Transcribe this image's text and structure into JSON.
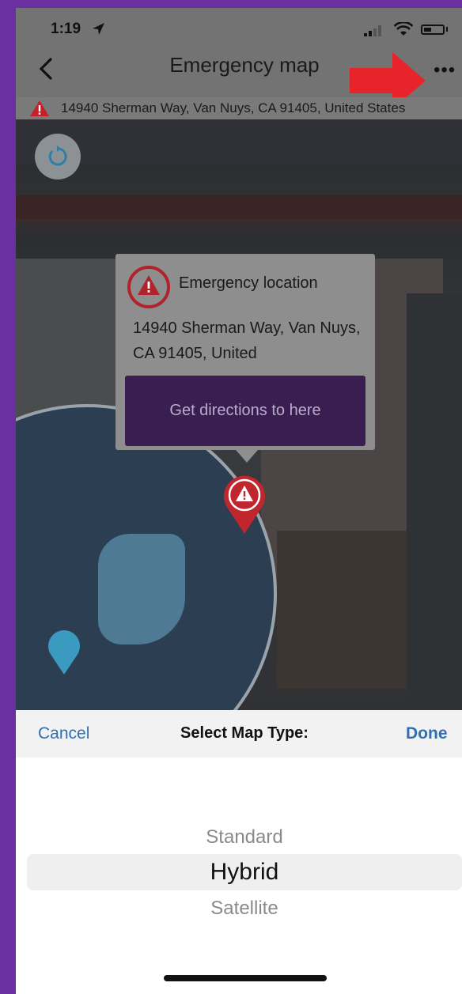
{
  "status": {
    "time": "1:19"
  },
  "nav": {
    "title": "Emergency map",
    "more": "•••"
  },
  "address_bar": {
    "text": "14940 Sherman Way, Van Nuys, CA  91405, United States"
  },
  "callout": {
    "title": "Emergency location",
    "address": "14940 Sherman Way, Van Nuys, CA  91405, United",
    "button": "Get directions to here"
  },
  "picker": {
    "cancel": "Cancel",
    "title": "Select Map Type:",
    "done": "Done",
    "options": [
      "Standard",
      "Hybrid",
      "Satellite"
    ],
    "selected": "Hybrid"
  },
  "colors": {
    "frame": "#6a2fa0",
    "accent_red": "#c8202a",
    "ios_blue": "#2f6fb3",
    "button_purple": "#3a1e52"
  }
}
